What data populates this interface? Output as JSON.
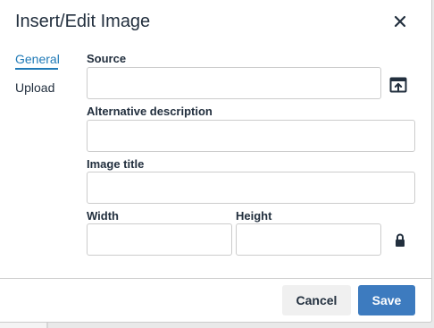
{
  "dialog": {
    "title": "Insert/Edit Image"
  },
  "tabs": [
    {
      "label": "General",
      "active": true
    },
    {
      "label": "Upload",
      "active": false
    }
  ],
  "fields": {
    "source": {
      "label": "Source",
      "value": "",
      "placeholder": ""
    },
    "alt": {
      "label": "Alternative description",
      "value": "",
      "placeholder": ""
    },
    "title": {
      "label": "Image title",
      "value": "",
      "placeholder": ""
    },
    "width": {
      "label": "Width",
      "value": "",
      "placeholder": ""
    },
    "height": {
      "label": "Height",
      "value": "",
      "placeholder": ""
    }
  },
  "icons": {
    "close": "close-icon",
    "browse": "browse-icon",
    "lock": "lock-icon"
  },
  "buttons": {
    "cancel": "Cancel",
    "save": "Save"
  },
  "colors": {
    "accent": "#207ab7",
    "primary_button": "#3d7bbf",
    "secondary_button": "#f0f0f0",
    "text": "#222f3e",
    "border": "#cccccc"
  }
}
